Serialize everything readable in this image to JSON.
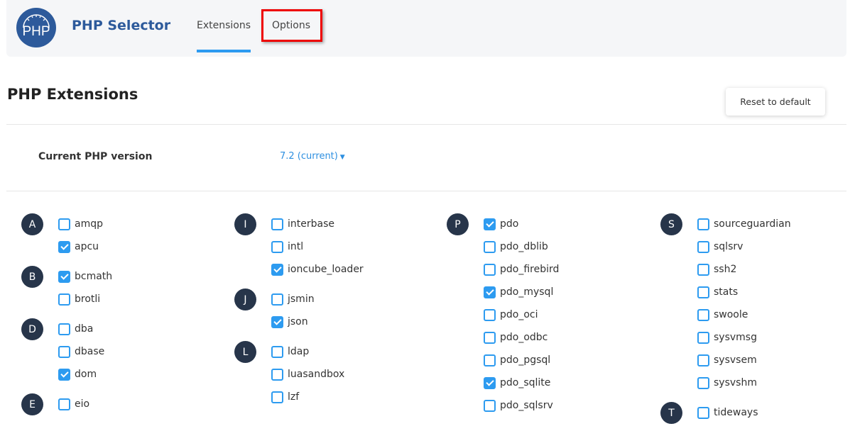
{
  "header": {
    "logo_text": "PHP",
    "title": "PHP Selector",
    "tabs": [
      {
        "label": "Extensions",
        "active": true
      },
      {
        "label": "Options",
        "active": false
      }
    ]
  },
  "page": {
    "title": "PHP Extensions",
    "reset_label": "Reset to default",
    "version_label": "Current PHP version",
    "version_value": "7.2 (current)"
  },
  "colors": {
    "accent": "#2d9bf0",
    "brand": "#2d5a9b",
    "badge": "#27354a",
    "highlight": "#ee0000"
  },
  "columns": [
    [
      {
        "letter": "A",
        "items": [
          {
            "name": "amqp",
            "checked": false
          },
          {
            "name": "apcu",
            "checked": true
          }
        ]
      },
      {
        "letter": "B",
        "items": [
          {
            "name": "bcmath",
            "checked": true
          },
          {
            "name": "brotli",
            "checked": false
          }
        ]
      },
      {
        "letter": "D",
        "items": [
          {
            "name": "dba",
            "checked": false
          },
          {
            "name": "dbase",
            "checked": false
          },
          {
            "name": "dom",
            "checked": true
          }
        ]
      },
      {
        "letter": "E",
        "items": [
          {
            "name": "eio",
            "checked": false
          }
        ]
      }
    ],
    [
      {
        "letter": "I",
        "items": [
          {
            "name": "interbase",
            "checked": false
          },
          {
            "name": "intl",
            "checked": false
          },
          {
            "name": "ioncube_loader",
            "checked": true
          }
        ]
      },
      {
        "letter": "J",
        "items": [
          {
            "name": "jsmin",
            "checked": false
          },
          {
            "name": "json",
            "checked": true
          }
        ]
      },
      {
        "letter": "L",
        "items": [
          {
            "name": "ldap",
            "checked": false
          },
          {
            "name": "luasandbox",
            "checked": false
          },
          {
            "name": "lzf",
            "checked": false
          }
        ]
      }
    ],
    [
      {
        "letter": "P",
        "items": [
          {
            "name": "pdo",
            "checked": true
          },
          {
            "name": "pdo_dblib",
            "checked": false
          },
          {
            "name": "pdo_firebird",
            "checked": false
          },
          {
            "name": "pdo_mysql",
            "checked": true
          },
          {
            "name": "pdo_oci",
            "checked": false
          },
          {
            "name": "pdo_odbc",
            "checked": false
          },
          {
            "name": "pdo_pgsql",
            "checked": false
          },
          {
            "name": "pdo_sqlite",
            "checked": true
          },
          {
            "name": "pdo_sqlsrv",
            "checked": false
          }
        ]
      }
    ],
    [
      {
        "letter": "S",
        "items": [
          {
            "name": "sourceguardian",
            "checked": false
          },
          {
            "name": "sqlsrv",
            "checked": false
          },
          {
            "name": "ssh2",
            "checked": false
          },
          {
            "name": "stats",
            "checked": false
          },
          {
            "name": "swoole",
            "checked": false
          },
          {
            "name": "sysvmsg",
            "checked": false
          },
          {
            "name": "sysvsem",
            "checked": false
          },
          {
            "name": "sysvshm",
            "checked": false
          }
        ]
      },
      {
        "letter": "T",
        "items": [
          {
            "name": "tideways",
            "checked": false
          }
        ]
      }
    ]
  ]
}
